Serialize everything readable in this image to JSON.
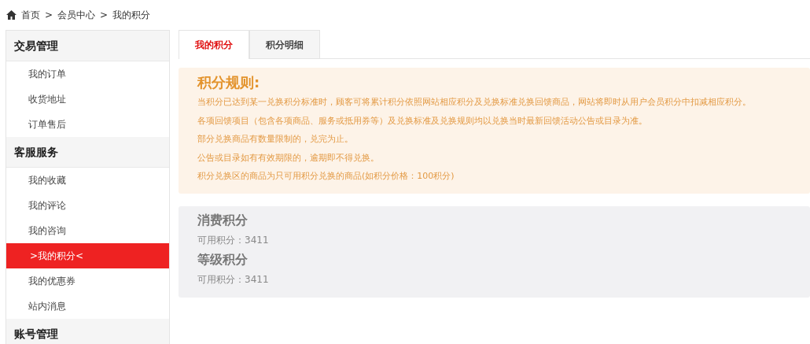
{
  "breadcrumb": {
    "items": [
      "首页",
      "会员中心",
      "我的积分"
    ],
    "separator": ">"
  },
  "sidebar": {
    "groups": [
      {
        "title": "交易管理",
        "items": [
          {
            "label": "我的订单",
            "selected": false
          },
          {
            "label": "收货地址",
            "selected": false
          },
          {
            "label": "订单售后",
            "selected": false
          }
        ]
      },
      {
        "title": "客服服务",
        "items": [
          {
            "label": "我的收藏",
            "selected": false
          },
          {
            "label": "我的评论",
            "selected": false
          },
          {
            "label": "我的咨询",
            "selected": false
          },
          {
            "label": ">我的积分<",
            "selected": true
          },
          {
            "label": "我的优惠券",
            "selected": false
          },
          {
            "label": "站内消息",
            "selected": false
          }
        ]
      },
      {
        "title": "账号管理"
      }
    ]
  },
  "tabs": [
    {
      "label": "我的积分",
      "selected": true
    },
    {
      "label": "积分明细",
      "selected": false
    }
  ],
  "rules": {
    "title": "积分规则:",
    "lines": [
      "当积分已达到某一兑换积分标准时，顾客可将累计积分依照网站相应积分及兑换标准兑换回馈商品，网站将即时从用户会员积分中扣减相应积分。",
      "各项回馈项目（包含各项商品、服务或抵用券等）及兑换标准及兑换规则均以兑换当时最新回馈活动公告或目录为准。",
      "部分兑换商品有数量限制的，兑完为止。",
      "公告或目录如有有效期限的，逾期即不得兑换。",
      "积分兑换区的商品为只可用积分兑换的商品(如积分价格：100积分)"
    ]
  },
  "points": [
    {
      "title": "消费积分",
      "detail": "可用积分：3411"
    },
    {
      "title": "等级积分",
      "detail": "可用积分：3411"
    }
  ]
}
